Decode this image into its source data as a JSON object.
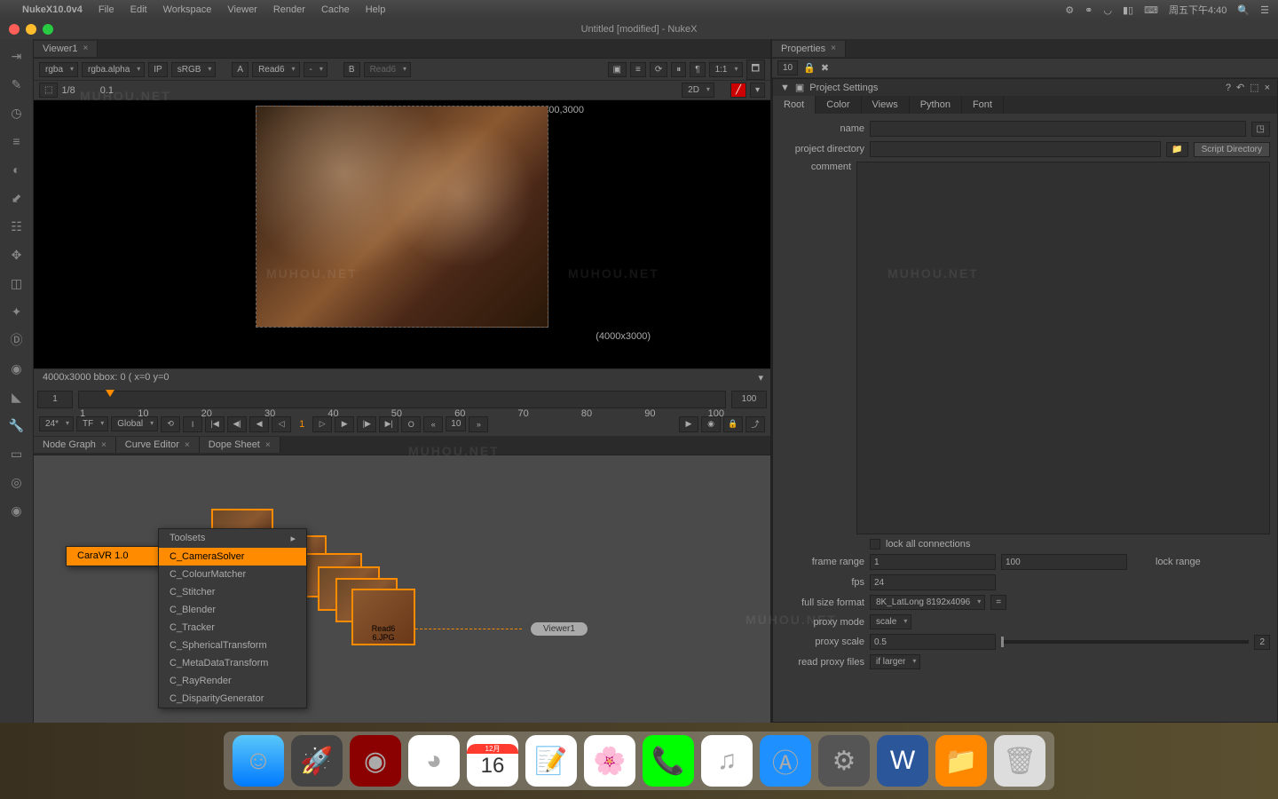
{
  "menubar": {
    "app": "NukeX10.0v4",
    "items": [
      "File",
      "Edit",
      "Workspace",
      "Viewer",
      "Render",
      "Cache",
      "Help"
    ],
    "clock": "周五下午4:40"
  },
  "window": {
    "title": "Untitled [modified] - NukeX"
  },
  "viewer": {
    "tab": "Viewer1",
    "channel": "rgba",
    "alpha": "rgba.alpha",
    "ip": "IP",
    "lut": "sRGB",
    "inputA": "A",
    "readA": "Read6",
    "dash": "-",
    "inputB": "B",
    "readB": "Read6",
    "ratio": "1:1",
    "mode2d": "2D",
    "gain": "1/8",
    "gamma": "0.1",
    "dim_top": "4000,3000",
    "dim_side": "(4000x3000)",
    "info": "4000x3000  bbox: 0 (  x=0 y=0"
  },
  "timeline": {
    "start": "1",
    "end": "100",
    "ticks": [
      "1",
      "10",
      "20",
      "30",
      "40",
      "50",
      "60",
      "70",
      "80",
      "90",
      "100"
    ]
  },
  "playback": {
    "fps": "24*",
    "tf": "TF",
    "global": "Global",
    "current": "1",
    "skip": "10"
  },
  "nodegraph": {
    "tabs": [
      "Node Graph",
      "Curve Editor",
      "Dope Sheet"
    ],
    "read_label": "Read6\n6.JPG",
    "viewer_node": "Viewer1"
  },
  "contextmenu": {
    "parent": "CaraVR 1.0",
    "sub_header": "Toolsets",
    "items": [
      "C_CameraSolver",
      "C_ColourMatcher",
      "C_Stitcher",
      "C_Blender",
      "C_Tracker",
      "C_SphericalTransform",
      "C_MetaDataTransform",
      "C_RayRender",
      "C_DisparityGenerator"
    ]
  },
  "properties": {
    "title": "Properties",
    "count": "10",
    "section": "Project Settings",
    "tabs": [
      "Root",
      "Color",
      "Views",
      "Python",
      "Font"
    ],
    "labels": {
      "name": "name",
      "dir": "project directory",
      "comment": "comment",
      "lock": "lock all connections",
      "frange": "frame range",
      "lrange": "lock range",
      "fps": "fps",
      "format": "full size format",
      "pmode": "proxy mode",
      "pscale": "proxy scale",
      "pfiles": "read proxy files"
    },
    "values": {
      "frange1": "1",
      "frange2": "100",
      "fps": "24",
      "format": "8K_LatLong 8192x4096",
      "pmode": "scale",
      "pscale": "0.5",
      "pscale_n": "2",
      "pfiles": "if larger"
    },
    "script_dir": "Script Directory"
  },
  "watermark": "MUHOU.NET"
}
